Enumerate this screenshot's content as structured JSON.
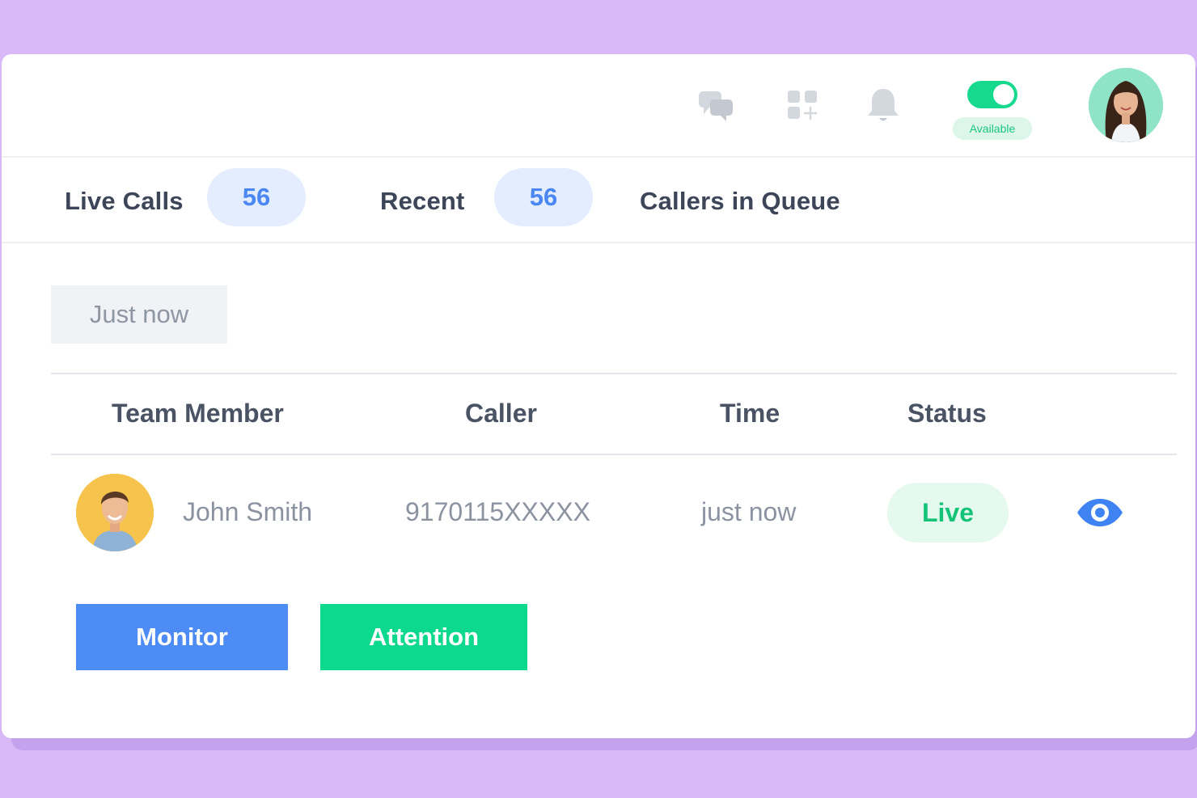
{
  "header": {
    "icons": [
      "chat-icon",
      "apps-add-icon",
      "bell-icon"
    ],
    "availability": {
      "enabled": true,
      "label": "Available"
    },
    "avatar": "user-avatar"
  },
  "tabs": [
    {
      "label": "Live Calls",
      "count": "56"
    },
    {
      "label": "Recent",
      "count": "56"
    },
    {
      "label": "Callers in Queue"
    }
  ],
  "filter": {
    "time_label": "Just now"
  },
  "table": {
    "columns": [
      "Team Member",
      "Caller",
      "Time",
      "Status"
    ],
    "rows": [
      {
        "member": "John Smith",
        "caller": "9170115XXXXX",
        "time": "just now",
        "status": "Live",
        "action_icon": "eye-icon"
      }
    ]
  },
  "actions": {
    "monitor_label": "Monitor",
    "attention_label": "Attention"
  },
  "colors": {
    "background": "#d9b8f7",
    "primary": "#4d8bf5",
    "success": "#0cd88e",
    "live": "#14c378"
  }
}
